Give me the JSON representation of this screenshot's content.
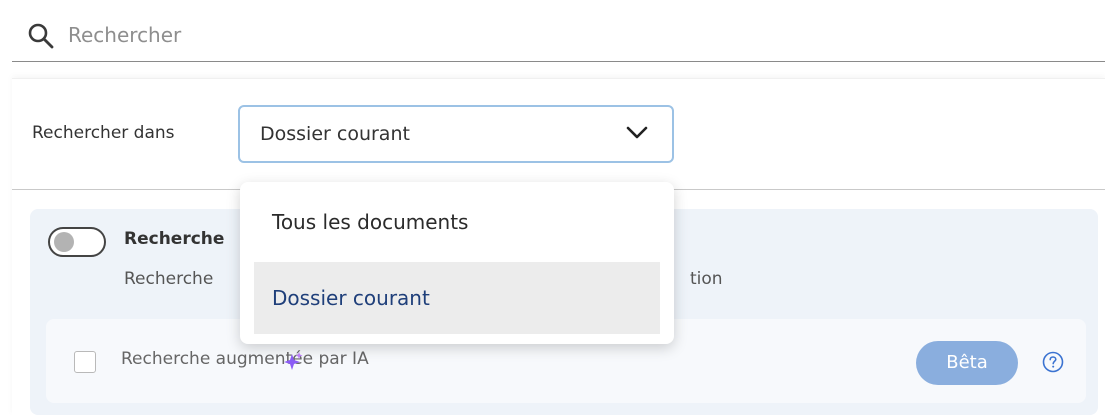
{
  "search": {
    "placeholder": "Rechercher",
    "icon": "search-icon"
  },
  "scope": {
    "label": "Rechercher dans",
    "selected": "Dossier courant",
    "options": [
      "Tous les documents",
      "Dossier courant"
    ],
    "highlighted_index": 1
  },
  "options": {
    "toggle_title_visible": "Recherche",
    "toggle_desc_visible": "Recherche",
    "toggle_desc_tail": "tion",
    "toggle_on": false,
    "ai_search": {
      "label": "Recherche augmentée par IA",
      "checked": false,
      "badge": "Bêta",
      "icon": "sparkle-icon",
      "help_icon": "help-icon"
    }
  },
  "colors": {
    "select_border": "#9cc2e5",
    "badge_bg": "#8aaede",
    "options_bg": "#eef3f9",
    "highlight_text": "#1f3f7a",
    "sparkle": "#8b5cf6"
  }
}
